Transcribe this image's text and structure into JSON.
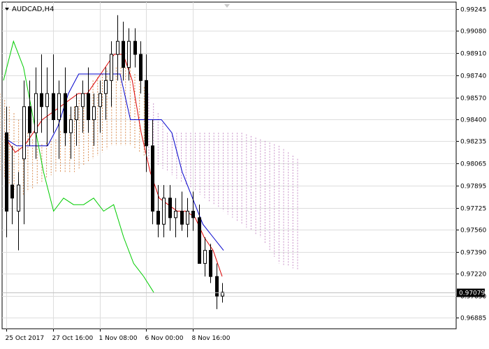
{
  "chart_data": {
    "type": "candlestick",
    "symbol_label": "AUDCAD,H4",
    "ylim": [
      0.968,
      0.993
    ],
    "y_ticks": [
      "0.99245",
      "0.99080",
      "0.98910",
      "0.98740",
      "0.98570",
      "0.98400",
      "0.98235",
      "0.98065",
      "0.97895",
      "0.97725",
      "0.97560",
      "0.97390",
      "0.97220",
      "0.97050",
      "0.96885"
    ],
    "current_price": "0.97079",
    "current_price_value": 0.97079,
    "x_ticks": [
      "25 Oct 2017",
      "27 Oct 16:00",
      "1 Nov 08:00",
      "6 Nov 00:00",
      "8 Nov 16:00"
    ],
    "grid": true,
    "colors": {
      "tenkan": "#dd0000",
      "kijun": "#0000cc",
      "chikou": "#00cc00",
      "cloud": "#d98c50",
      "cloud_b": "#c892c8",
      "candle": "#000000",
      "grid": "#dddddd",
      "axis": "#000000"
    },
    "candles": [
      {
        "o": 0.983,
        "h": 0.985,
        "l": 0.975,
        "c": 0.977
      },
      {
        "o": 0.979,
        "h": 0.982,
        "l": 0.976,
        "c": 0.978
      },
      {
        "o": 0.977,
        "h": 0.98,
        "l": 0.974,
        "c": 0.979
      },
      {
        "o": 0.981,
        "h": 0.987,
        "l": 0.976,
        "c": 0.985
      },
      {
        "o": 0.985,
        "h": 0.987,
        "l": 0.982,
        "c": 0.983
      },
      {
        "o": 0.983,
        "h": 0.988,
        "l": 0.981,
        "c": 0.986
      },
      {
        "o": 0.986,
        "h": 0.989,
        "l": 0.983,
        "c": 0.985
      },
      {
        "o": 0.985,
        "h": 0.988,
        "l": 0.982,
        "c": 0.986
      },
      {
        "o": 0.986,
        "h": 0.989,
        "l": 0.983,
        "c": 0.984
      },
      {
        "o": 0.984,
        "h": 0.987,
        "l": 0.981,
        "c": 0.986
      },
      {
        "o": 0.986,
        "h": 0.988,
        "l": 0.982,
        "c": 0.983
      },
      {
        "o": 0.983,
        "h": 0.985,
        "l": 0.981,
        "c": 0.984
      },
      {
        "o": 0.984,
        "h": 0.986,
        "l": 0.982,
        "c": 0.985
      },
      {
        "o": 0.985,
        "h": 0.987,
        "l": 0.983,
        "c": 0.986
      },
      {
        "o": 0.986,
        "h": 0.988,
        "l": 0.983,
        "c": 0.984
      },
      {
        "o": 0.984,
        "h": 0.986,
        "l": 0.982,
        "c": 0.985
      },
      {
        "o": 0.985,
        "h": 0.987,
        "l": 0.983,
        "c": 0.986
      },
      {
        "o": 0.986,
        "h": 0.988,
        "l": 0.984,
        "c": 0.987
      },
      {
        "o": 0.987,
        "h": 0.99,
        "l": 0.985,
        "c": 0.989
      },
      {
        "o": 0.989,
        "h": 0.992,
        "l": 0.987,
        "c": 0.99
      },
      {
        "o": 0.99,
        "h": 0.9915,
        "l": 0.987,
        "c": 0.988
      },
      {
        "o": 0.988,
        "h": 0.991,
        "l": 0.987,
        "c": 0.99
      },
      {
        "o": 0.99,
        "h": 0.991,
        "l": 0.988,
        "c": 0.989
      },
      {
        "o": 0.989,
        "h": 0.99,
        "l": 0.986,
        "c": 0.987
      },
      {
        "o": 0.987,
        "h": 0.989,
        "l": 0.98,
        "c": 0.982
      },
      {
        "o": 0.982,
        "h": 0.984,
        "l": 0.976,
        "c": 0.977
      },
      {
        "o": 0.977,
        "h": 0.979,
        "l": 0.975,
        "c": 0.976
      },
      {
        "o": 0.976,
        "h": 0.979,
        "l": 0.975,
        "c": 0.978
      },
      {
        "o": 0.978,
        "h": 0.979,
        "l": 0.9755,
        "c": 0.9765
      },
      {
        "o": 0.9765,
        "h": 0.978,
        "l": 0.975,
        "c": 0.977
      },
      {
        "o": 0.977,
        "h": 0.9785,
        "l": 0.9755,
        "c": 0.976
      },
      {
        "o": 0.976,
        "h": 0.978,
        "l": 0.975,
        "c": 0.977
      },
      {
        "o": 0.977,
        "h": 0.9785,
        "l": 0.9755,
        "c": 0.9765
      },
      {
        "o": 0.9765,
        "h": 0.9775,
        "l": 0.974,
        "c": 0.973
      },
      {
        "o": 0.973,
        "h": 0.975,
        "l": 0.972,
        "c": 0.974
      },
      {
        "o": 0.974,
        "h": 0.9745,
        "l": 0.9715,
        "c": 0.972
      },
      {
        "o": 0.972,
        "h": 0.973,
        "l": 0.9695,
        "c": 0.9705
      },
      {
        "o": 0.9705,
        "h": 0.9715,
        "l": 0.97,
        "c": 0.97079
      }
    ],
    "series": [
      {
        "key": "tenkan",
        "values": [
          0.9825,
          0.9815,
          0.982,
          0.983,
          0.984,
          0.9845,
          0.985,
          0.9855,
          0.986,
          0.986,
          0.987,
          0.988,
          0.989,
          0.989,
          0.987,
          0.983,
          0.98,
          0.978,
          0.9775,
          0.977,
          0.977,
          0.9765,
          0.975,
          0.974,
          0.972
        ]
      },
      {
        "key": "kijun",
        "values": [
          0.9825,
          0.982,
          0.982,
          0.982,
          0.982,
          0.9835,
          0.986,
          0.9875,
          0.9875,
          0.9875,
          0.9875,
          0.9875,
          0.984,
          0.984,
          0.984,
          0.984,
          0.983,
          0.98,
          0.978,
          0.976,
          0.975,
          0.974
        ]
      },
      {
        "key": "chikou",
        "values": [
          0.987,
          0.99,
          0.988,
          0.984,
          0.98,
          0.977,
          0.978,
          0.9775,
          0.9775,
          0.978,
          0.977,
          0.9775,
          0.975,
          0.973,
          0.972,
          0.97079
        ]
      }
    ],
    "cloud_upper": [
      0.986,
      0.984,
      0.982,
      0.9825,
      0.985,
      0.987,
      0.988,
      0.988,
      0.986,
      0.983,
      0.983,
      0.983,
      0.983,
      0.983,
      0.9825,
      0.982,
      0.981
    ],
    "cloud_lower": [
      0.98,
      0.978,
      0.979,
      0.98,
      0.98,
      0.981,
      0.982,
      0.982,
      0.981,
      0.98,
      0.979,
      0.978,
      0.977,
      0.976,
      0.975,
      0.973,
      0.9725
    ]
  }
}
